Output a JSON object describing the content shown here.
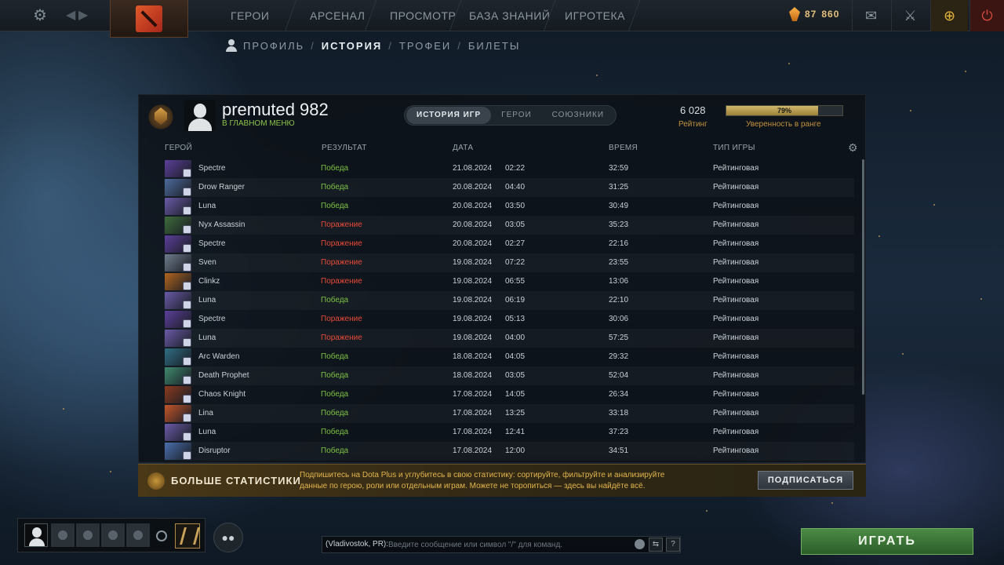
{
  "topbar": {
    "nav": [
      "ГЕРОИ",
      "АРСЕНАЛ",
      "ПРОСМОТР",
      "БАЗА ЗНАНИЙ",
      "ИГРОТЕКА"
    ],
    "currency_primary": "87",
    "currency_secondary": "860"
  },
  "subnav": {
    "profile": "ПРОФИЛЬ",
    "history": "ИСТОРИЯ",
    "trophies": "ТРОФЕИ",
    "tickets": "БИЛЕТЫ"
  },
  "player": {
    "name": "premuted 982",
    "status": "В ГЛАВНОМ МЕНЮ",
    "rating": "6 028",
    "rating_label": "Рейтинг",
    "confidence": "79%",
    "confidence_value": 0.79,
    "confidence_label": "Уверенность в ранге"
  },
  "tabs": [
    "ИСТОРИЯ ИГР",
    "ГЕРОИ",
    "СОЮЗНИКИ"
  ],
  "columns": {
    "hero": "ГЕРОЙ",
    "result": "РЕЗУЛЬТАТ",
    "date": "ДАТА",
    "duration": "ВРЕМЯ",
    "game_type": "ТИП ИГРЫ"
  },
  "matches": [
    {
      "hero": "Spectre",
      "result": "Победа",
      "win": true,
      "date": "21.08.2024",
      "time": "02:22",
      "duration": "32:59",
      "type": "Рейтинговая",
      "color": "#5b3f9a"
    },
    {
      "hero": "Drow Ranger",
      "result": "Победа",
      "win": true,
      "date": "20.08.2024",
      "time": "04:40",
      "duration": "31:25",
      "type": "Рейтинговая",
      "color": "#4d6b9e"
    },
    {
      "hero": "Luna",
      "result": "Победа",
      "win": true,
      "date": "20.08.2024",
      "time": "03:50",
      "duration": "30:49",
      "type": "Рейтинговая",
      "color": "#6a5aa8"
    },
    {
      "hero": "Nyx Assassin",
      "result": "Поражение",
      "win": false,
      "date": "20.08.2024",
      "time": "03:05",
      "duration": "35:23",
      "type": "Рейтинговая",
      "color": "#3e6b3a"
    },
    {
      "hero": "Spectre",
      "result": "Поражение",
      "win": false,
      "date": "20.08.2024",
      "time": "02:27",
      "duration": "22:16",
      "type": "Рейтинговая",
      "color": "#5b3f9a"
    },
    {
      "hero": "Sven",
      "result": "Поражение",
      "win": false,
      "date": "19.08.2024",
      "time": "07:22",
      "duration": "23:55",
      "type": "Рейтинговая",
      "color": "#6e7c8c"
    },
    {
      "hero": "Clinkz",
      "result": "Поражение",
      "win": false,
      "date": "19.08.2024",
      "time": "06:55",
      "duration": "13:06",
      "type": "Рейтинговая",
      "color": "#b0641f"
    },
    {
      "hero": "Luna",
      "result": "Победа",
      "win": true,
      "date": "19.08.2024",
      "time": "06:19",
      "duration": "22:10",
      "type": "Рейтинговая",
      "color": "#6a5aa8"
    },
    {
      "hero": "Spectre",
      "result": "Поражение",
      "win": false,
      "date": "19.08.2024",
      "time": "05:13",
      "duration": "30:06",
      "type": "Рейтинговая",
      "color": "#5b3f9a"
    },
    {
      "hero": "Luna",
      "result": "Поражение",
      "win": false,
      "date": "19.08.2024",
      "time": "04:00",
      "duration": "57:25",
      "type": "Рейтинговая",
      "color": "#6a5aa8"
    },
    {
      "hero": "Arc Warden",
      "result": "Победа",
      "win": true,
      "date": "18.08.2024",
      "time": "04:05",
      "duration": "29:32",
      "type": "Рейтинговая",
      "color": "#2f6e84"
    },
    {
      "hero": "Death Prophet",
      "result": "Победа",
      "win": true,
      "date": "18.08.2024",
      "time": "03:05",
      "duration": "52:04",
      "type": "Рейтинговая",
      "color": "#3f8a6e"
    },
    {
      "hero": "Chaos Knight",
      "result": "Победа",
      "win": true,
      "date": "17.08.2024",
      "time": "14:05",
      "duration": "26:34",
      "type": "Рейтинговая",
      "color": "#8a3a1e"
    },
    {
      "hero": "Lina",
      "result": "Победа",
      "win": true,
      "date": "17.08.2024",
      "time": "13:25",
      "duration": "33:18",
      "type": "Рейтинговая",
      "color": "#c4552a"
    },
    {
      "hero": "Luna",
      "result": "Победа",
      "win": true,
      "date": "17.08.2024",
      "time": "12:41",
      "duration": "37:23",
      "type": "Рейтинговая",
      "color": "#6a5aa8"
    },
    {
      "hero": "Disruptor",
      "result": "Победа",
      "win": true,
      "date": "17.08.2024",
      "time": "12:00",
      "duration": "34:51",
      "type": "Рейтинговая",
      "color": "#4a6fae"
    }
  ],
  "plus": {
    "title": "БОЛЬШЕ СТАТИСТИКИ",
    "text": "Подпишитесь на Dota Plus и углубитесь в свою статистику: сортируйте, фильтруйте и анализируйте данные по герою, роли или отдельным играм. Можете не торопиться — здесь вы найдёте всё.",
    "button": "ПОДПИСАТЬСЯ"
  },
  "chat": {
    "channel": "(Vladivostok, PR):",
    "placeholder": "Введите сообщение или символ \"/\" для команд.",
    "help": "?"
  },
  "play_button": "ИГРАТЬ",
  "colors": {
    "win": "#7cc243",
    "loss": "#e84a3a",
    "gold": "#c2923e",
    "play": "#4c8a45"
  }
}
